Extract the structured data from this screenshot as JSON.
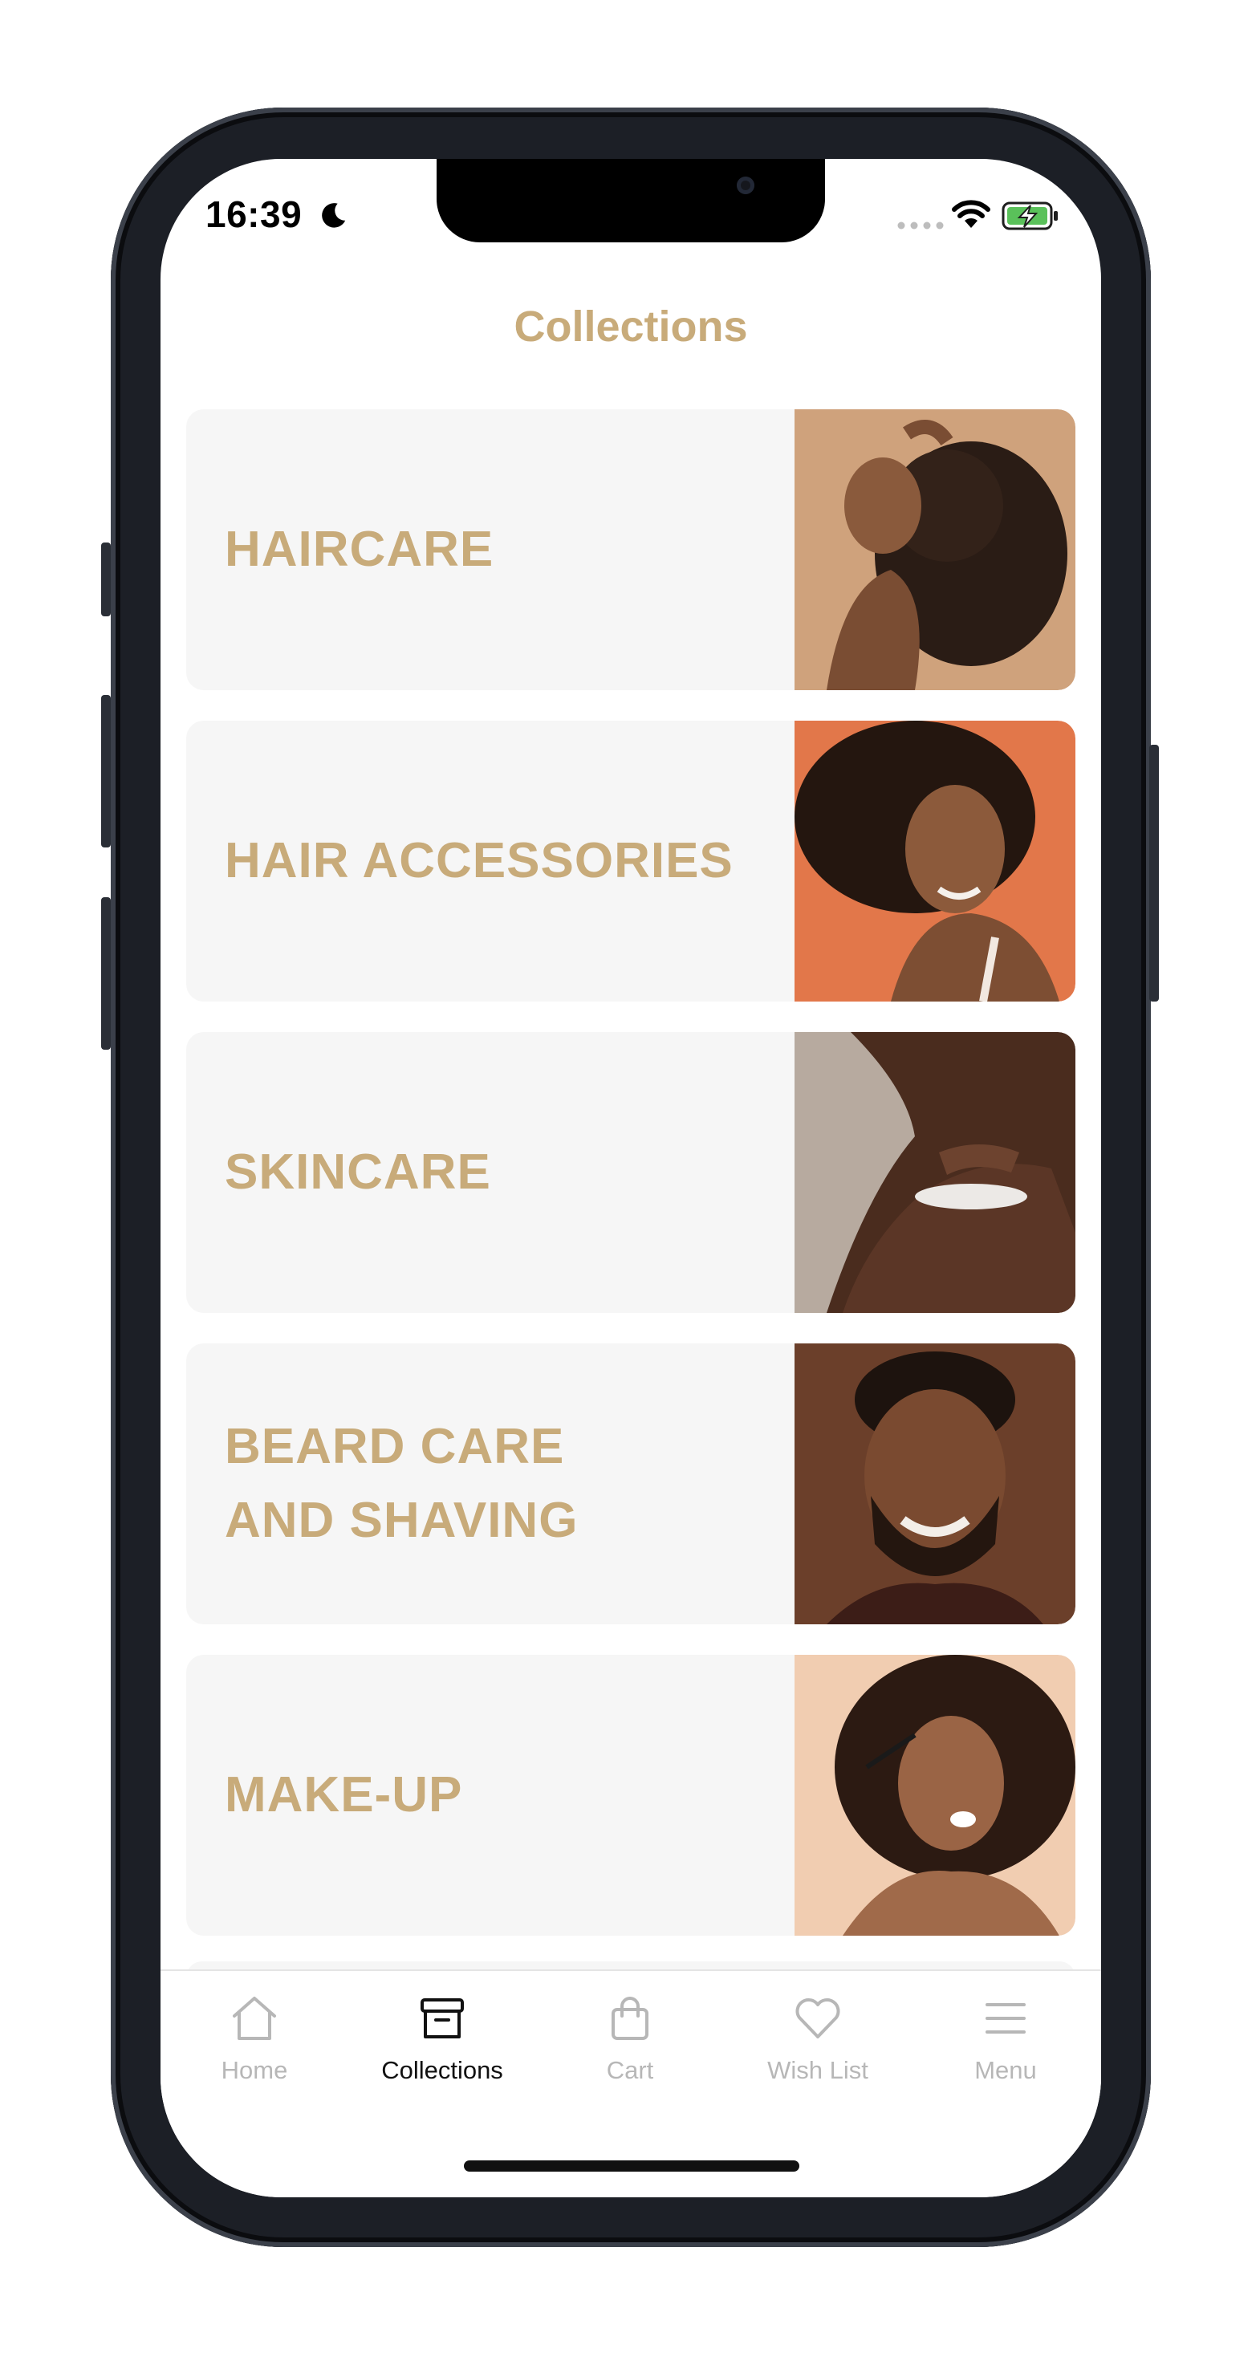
{
  "status_bar": {
    "time": "16:39",
    "icons": [
      "moon-icon",
      "signal-dots-icon",
      "wifi-icon",
      "battery-charging-icon"
    ]
  },
  "header": {
    "title": "Collections"
  },
  "colors": {
    "accent": "#c8ab7a",
    "card_bg": "#f6f6f6",
    "inactive": "#b7b7b7",
    "active": "#111111"
  },
  "collections": [
    {
      "label": "HAIRCARE",
      "image": "woman-curly-hair-photo"
    },
    {
      "label": "HAIR ACCESSORIES",
      "image": "woman-smiling-orange-photo"
    },
    {
      "label": "SKINCARE",
      "image": "shoulder-cream-photo"
    },
    {
      "label": "BEARD CARE\nAND SHAVING",
      "image": "bearded-man-photo"
    },
    {
      "label": "MAKE-UP",
      "image": "woman-mascara-photo"
    }
  ],
  "tab_bar": {
    "tabs": [
      {
        "label": "Home",
        "icon": "home-icon",
        "active": false
      },
      {
        "label": "Collections",
        "icon": "archive-box-icon",
        "active": true
      },
      {
        "label": "Cart",
        "icon": "shopping-bag-icon",
        "active": false
      },
      {
        "label": "Wish List",
        "icon": "heart-icon",
        "active": false
      },
      {
        "label": "Menu",
        "icon": "menu-icon",
        "active": false
      }
    ]
  }
}
